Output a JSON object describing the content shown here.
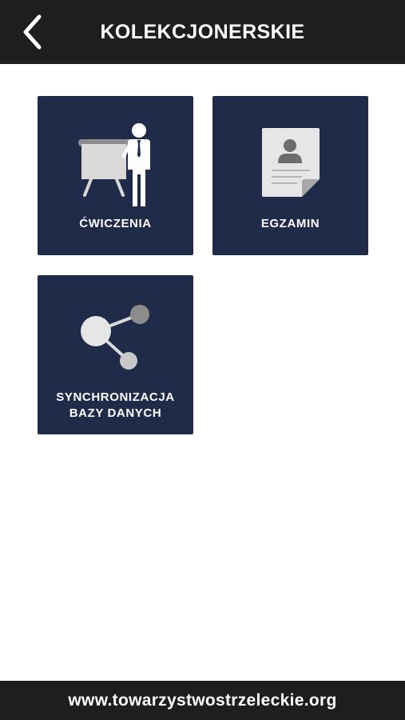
{
  "header": {
    "title": "KOLEKCJONERSKIE",
    "back_icon": "chevron-left-icon"
  },
  "tiles": [
    {
      "label": "ĆWICZENIA",
      "icon": "presentation-board-icon"
    },
    {
      "label": "EGZAMIN",
      "icon": "document-person-icon"
    },
    {
      "label": "SYNCHRONIZACJA\nBAZY DANYCH",
      "icon": "share-nodes-icon"
    }
  ],
  "footer": {
    "link_text": "www.towarzystwostrzeleckie.org"
  },
  "colors": {
    "bar_background": "#1f1e1d",
    "tile_background": "#202b49",
    "icon_light": "#d9d9d9",
    "icon_gray": "#8c8c8c"
  }
}
